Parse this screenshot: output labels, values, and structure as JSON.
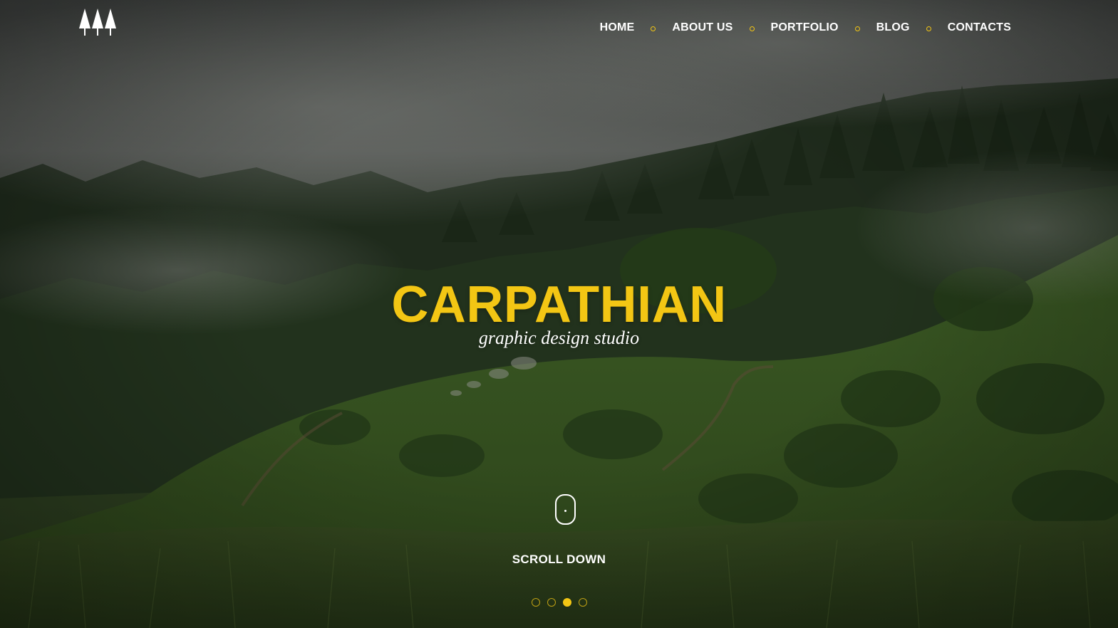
{
  "header": {
    "logo_icon": "three-trees-logo-icon",
    "nav": [
      {
        "label": "HOME"
      },
      {
        "label": "ABOUT US"
      },
      {
        "label": "PORTFOLIO"
      },
      {
        "label": "BLOG"
      },
      {
        "label": "CONTACTS"
      }
    ]
  },
  "hero": {
    "title": "CARPATHIAN",
    "subtitle": "graphic design studio",
    "scroll_icon": "mouse-scroll-icon",
    "scroll_label": "SCROLL DOWN"
  },
  "slider": {
    "total": 4,
    "active_index": 2
  },
  "colors": {
    "accent": "#f3c614",
    "text": "#ffffff"
  }
}
